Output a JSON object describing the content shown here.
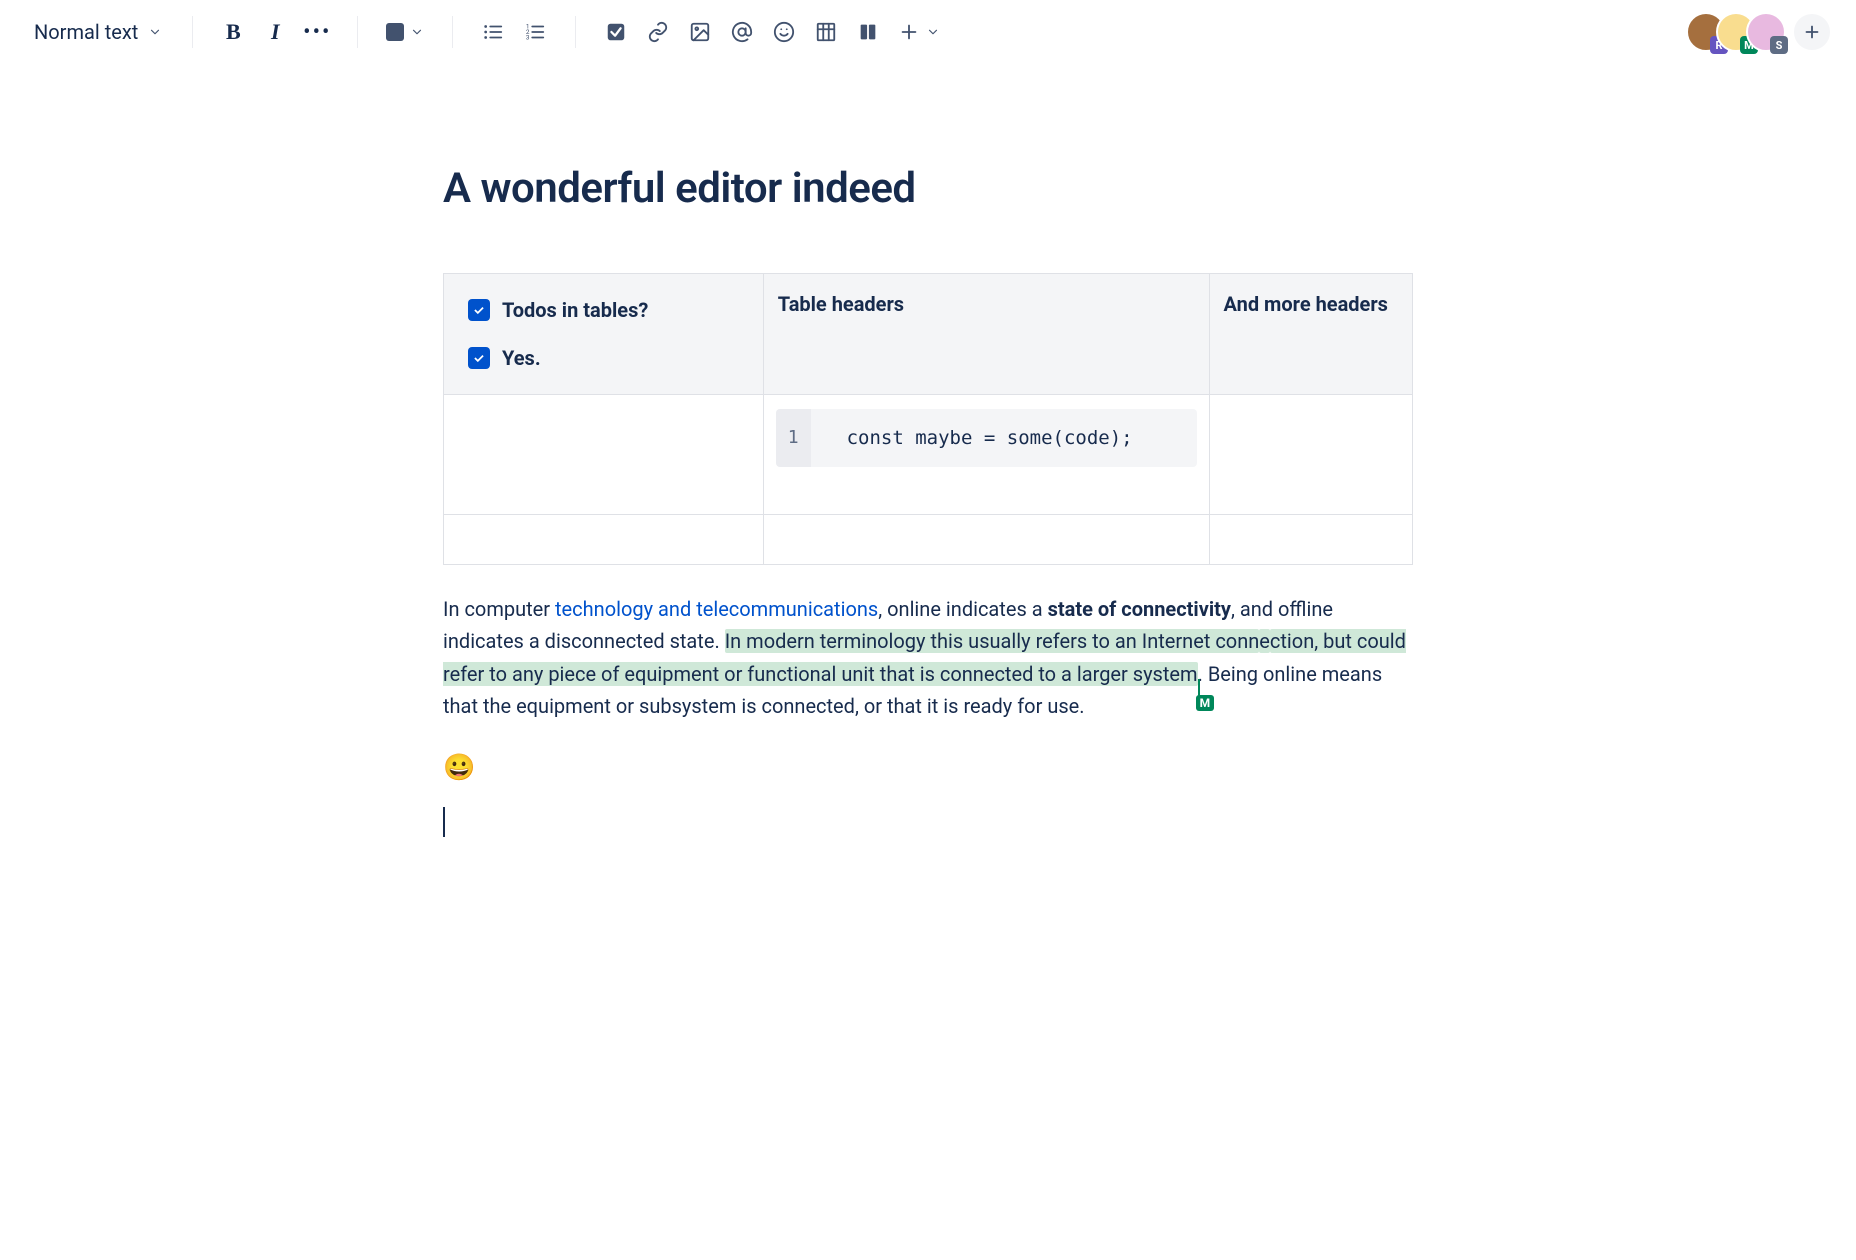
{
  "toolbar": {
    "text_style_label": "Normal text"
  },
  "avatars": {
    "users": [
      {
        "badge": "R",
        "badge_color": "#6554C0",
        "bg": "#a56f3e"
      },
      {
        "badge": "M",
        "badge_color": "#00875A",
        "bg": "#f9dd8f"
      },
      {
        "badge": "S",
        "badge_color": "#5E6C84",
        "bg": "#e8b9e0"
      }
    ]
  },
  "document": {
    "title": "A wonderful editor indeed",
    "table": {
      "header_cell_1_tasks": [
        {
          "checked": true,
          "label": "Todos in tables?"
        },
        {
          "checked": true,
          "label": "Yes."
        }
      ],
      "header_cell_2": "Table headers",
      "header_cell_3": "And more headers",
      "code": {
        "line_no": "1",
        "content": "const maybe = some(code);"
      }
    },
    "paragraph": {
      "t1": "In computer ",
      "link": "technology and telecommunications",
      "t2": ", online indicates a ",
      "bold": "state of connectivity",
      "t3": ", and offline indicates a disconnected state. ",
      "hl1": "In modern terminology this usually refers to an Internet conn",
      "hl_mid": "e",
      "hl2": "ction, but could refer to any piece of equipment or functional unit that is connected to a larger system",
      "collab_badge": "M",
      "t4": ". Being online means that the equipment or subsystem is connected, or that it is ready for use."
    },
    "emoji": "😀"
  }
}
